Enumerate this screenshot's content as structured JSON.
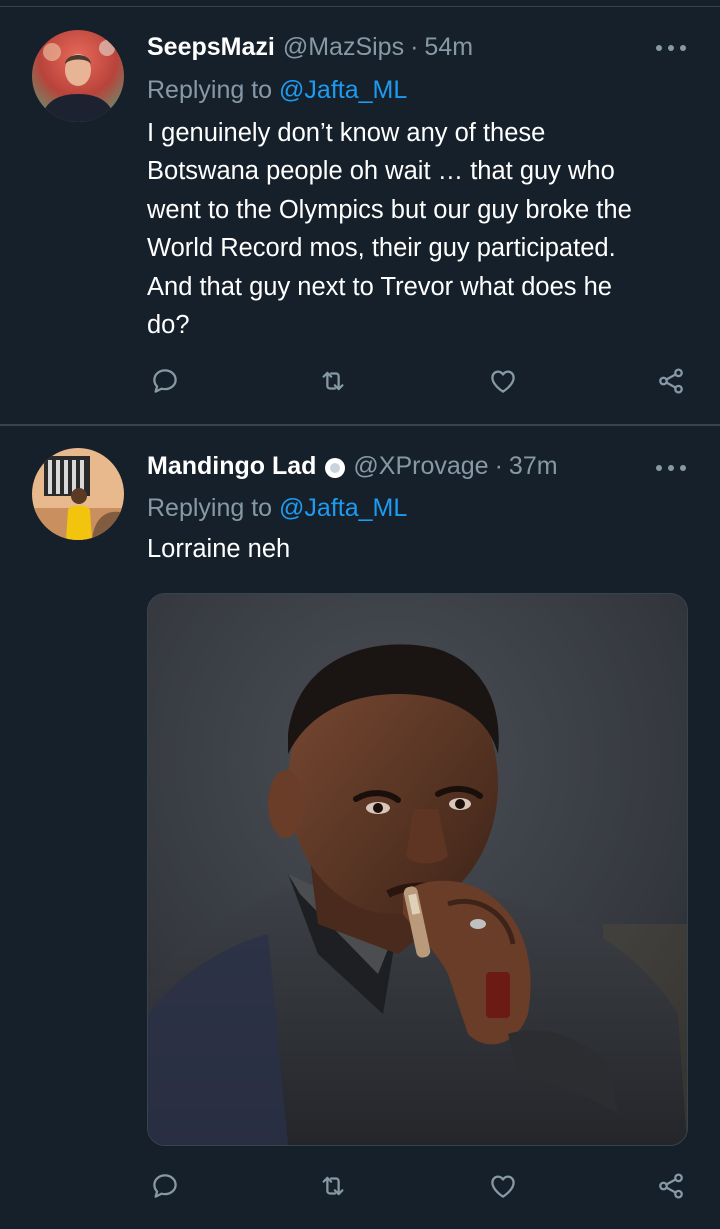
{
  "tweets": [
    {
      "display_name": "SeepsMazi",
      "handle": "@MazSips",
      "separator": "·",
      "time": "54m",
      "verified": false,
      "replying_prefix": "Replying to",
      "replying_to": "@Jafta_ML",
      "text": "I genuinely don’t know any of these\nBotswana people oh wait … that guy who\nwent to the Olympics but our guy broke the\nWorld Record mos, their guy participated.\nAnd that guy next to Trevor what does he\ndo?",
      "avatar_icon": "user-avatar",
      "actions": [
        "reply-icon",
        "retweet-icon",
        "like-icon",
        "share-icon"
      ]
    },
    {
      "display_name": "Mandingo Lad",
      "handle": "@XProvage",
      "separator": "·",
      "time": "37m",
      "verified": true,
      "replying_prefix": "Replying to",
      "replying_to": "@Jafta_ML",
      "text": "Lorraine neh",
      "avatar_icon": "user-avatar",
      "media_icon": "photo-man-smoking-cigar",
      "actions": [
        "reply-icon",
        "retweet-icon",
        "like-icon",
        "share-icon"
      ]
    }
  ],
  "colors": {
    "background": "#15202b",
    "text": "#ffffff",
    "secondary": "#8899a6",
    "link": "#1d9bf0",
    "divider": "#38444d"
  }
}
